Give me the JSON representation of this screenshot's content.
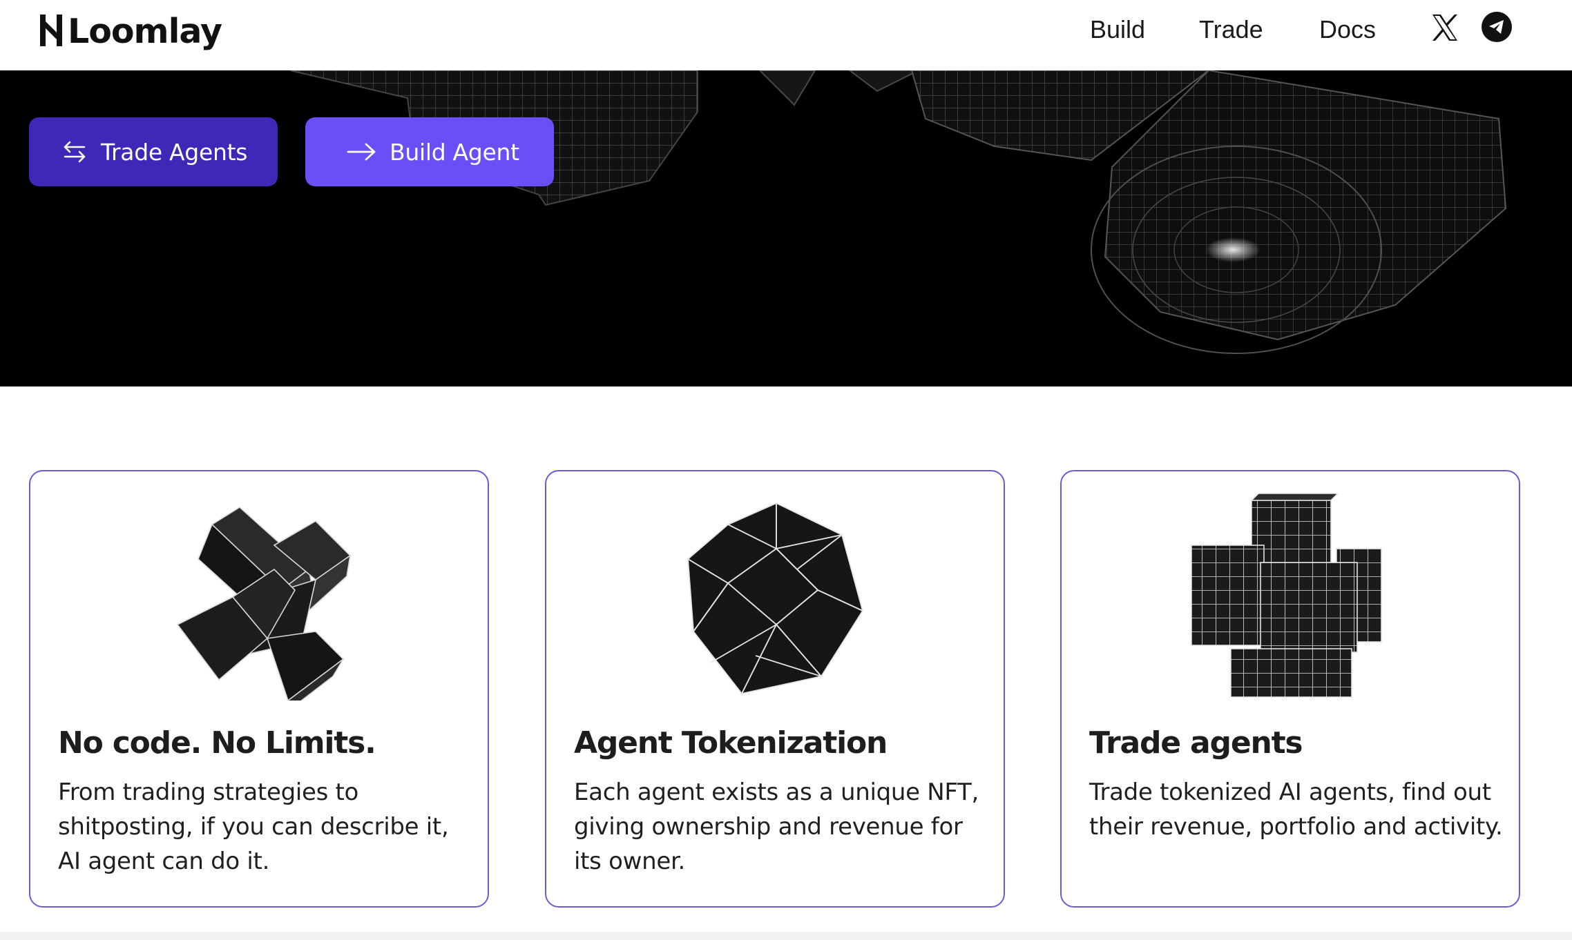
{
  "brand": {
    "name": "Loomlay"
  },
  "nav": {
    "links": [
      "Build",
      "Trade",
      "Docs"
    ],
    "social": [
      "x-icon",
      "telegram-icon"
    ]
  },
  "hero": {
    "buttons": {
      "trade_label": "Trade Agents",
      "build_label": "Build Agent"
    }
  },
  "cards": [
    {
      "title": "No code. No Limits.",
      "text": "From trading strategies to shitposting, if you can describe it, AI agent can do it.",
      "icon": "cross-cube-icon"
    },
    {
      "title": "Agent Tokenization",
      "text": "Each agent exists as a unique NFT, giving ownership and revenue for its owner.",
      "icon": "icosahedron-icon"
    },
    {
      "title": "Trade agents",
      "text": "Trade tokenized AI agents, find out their revenue, portfolio and activity.",
      "icon": "cube-cluster-icon"
    }
  ],
  "colors": {
    "trade_button": "#3d28b8",
    "build_button": "#6a4ff6",
    "card_border": "#6a5ad6",
    "hero_bg": "#000000"
  }
}
